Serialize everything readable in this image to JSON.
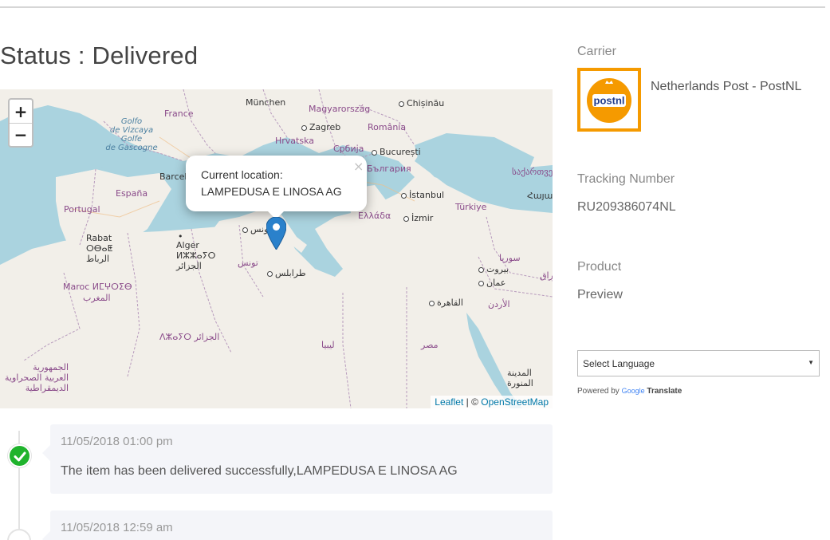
{
  "status": {
    "title": "Status : Delivered"
  },
  "map": {
    "zoom_in": "+",
    "zoom_out": "−",
    "popup": {
      "line1": "Current location:",
      "line2": "LAMPEDUSA E LINOSA AG",
      "close": "×"
    },
    "attribution": {
      "leaflet": "Leaflet",
      "separator": " | © ",
      "osm": "OpenStreetMap"
    },
    "labels": {
      "france": "France",
      "munchen": "München",
      "magyarorszag": "Magyarország",
      "chisinau": "Chișinău",
      "golfo1": "Golfo",
      "golfo2": "de Vizcaya",
      "golfo3": "Golfe",
      "golfo4": "de Gascogne",
      "zagreb": "Zagreb",
      "romania": "România",
      "hrvatska": "Hrvatska",
      "srbija": "Србија",
      "bucuresti": "București",
      "barcel": "Barcel",
      "bulgaria": "България",
      "sakartvelo": "საქართველ",
      "espana": "España",
      "istanbul": "İstanbul",
      "hayastan": "Հայաս",
      "portugal": "Portugal",
      "ellada": "Ελλάδα",
      "izmir": "İzmir",
      "turkiye": "Türkiye",
      "tunis": "تونس",
      "rabat1": "Rabat",
      "rabat2": "ⵔⴱⴰⵟ",
      "rabat3": "الرباط",
      "alger1": "Alger",
      "alger2": "ⵍⵣⵣⴰⵢⵔ",
      "alger3": "الجزائر",
      "tounes": "تونس",
      "syria": "سوريا",
      "beirut": "بيروت",
      "tarabulus": "طرابلس",
      "amman": "عمان",
      "iraq": "راق",
      "maroc1": "Maroc ⵍⵎⵖⵔⵉⴱ",
      "maroc2": "المغرب",
      "cairo": "القاهرة",
      "urdun": "الأردن",
      "dzayer": "ⴷⵣⴰⵢⵔ الجزائر",
      "libya": "ليبيا",
      "masr": "مصر",
      "sahara1": "الجمهورية",
      "sahara2": "العربية الصحراوية",
      "sahara3": "الديمقراطية",
      "madina1": "المدينة",
      "madina2": "المنورة"
    }
  },
  "sidebar": {
    "carrier_label": "Carrier",
    "carrier_name": "Netherlands Post - PostNL",
    "logo_text": "postnl",
    "tracking_label": "Tracking Number",
    "tracking_number": "RU209386074NL",
    "product_label": "Product",
    "product_value": "Preview",
    "language_select": "Select Language",
    "powered_by": "Powered by",
    "google": "Google",
    "translate": "Translate"
  },
  "timeline": [
    {
      "time": "11/05/2018 01:00 pm",
      "message": "The item has been delivered successfully,LAMPEDUSA E LINOSA AG"
    },
    {
      "time": "11/05/2018 12:59 am",
      "message": ""
    }
  ],
  "colors": {
    "postnl_orange": "#f59a00",
    "success_green": "#1fb32c",
    "marker_blue": "#2a81cb",
    "sea": "#aad3df",
    "land": "#f2efe9"
  }
}
